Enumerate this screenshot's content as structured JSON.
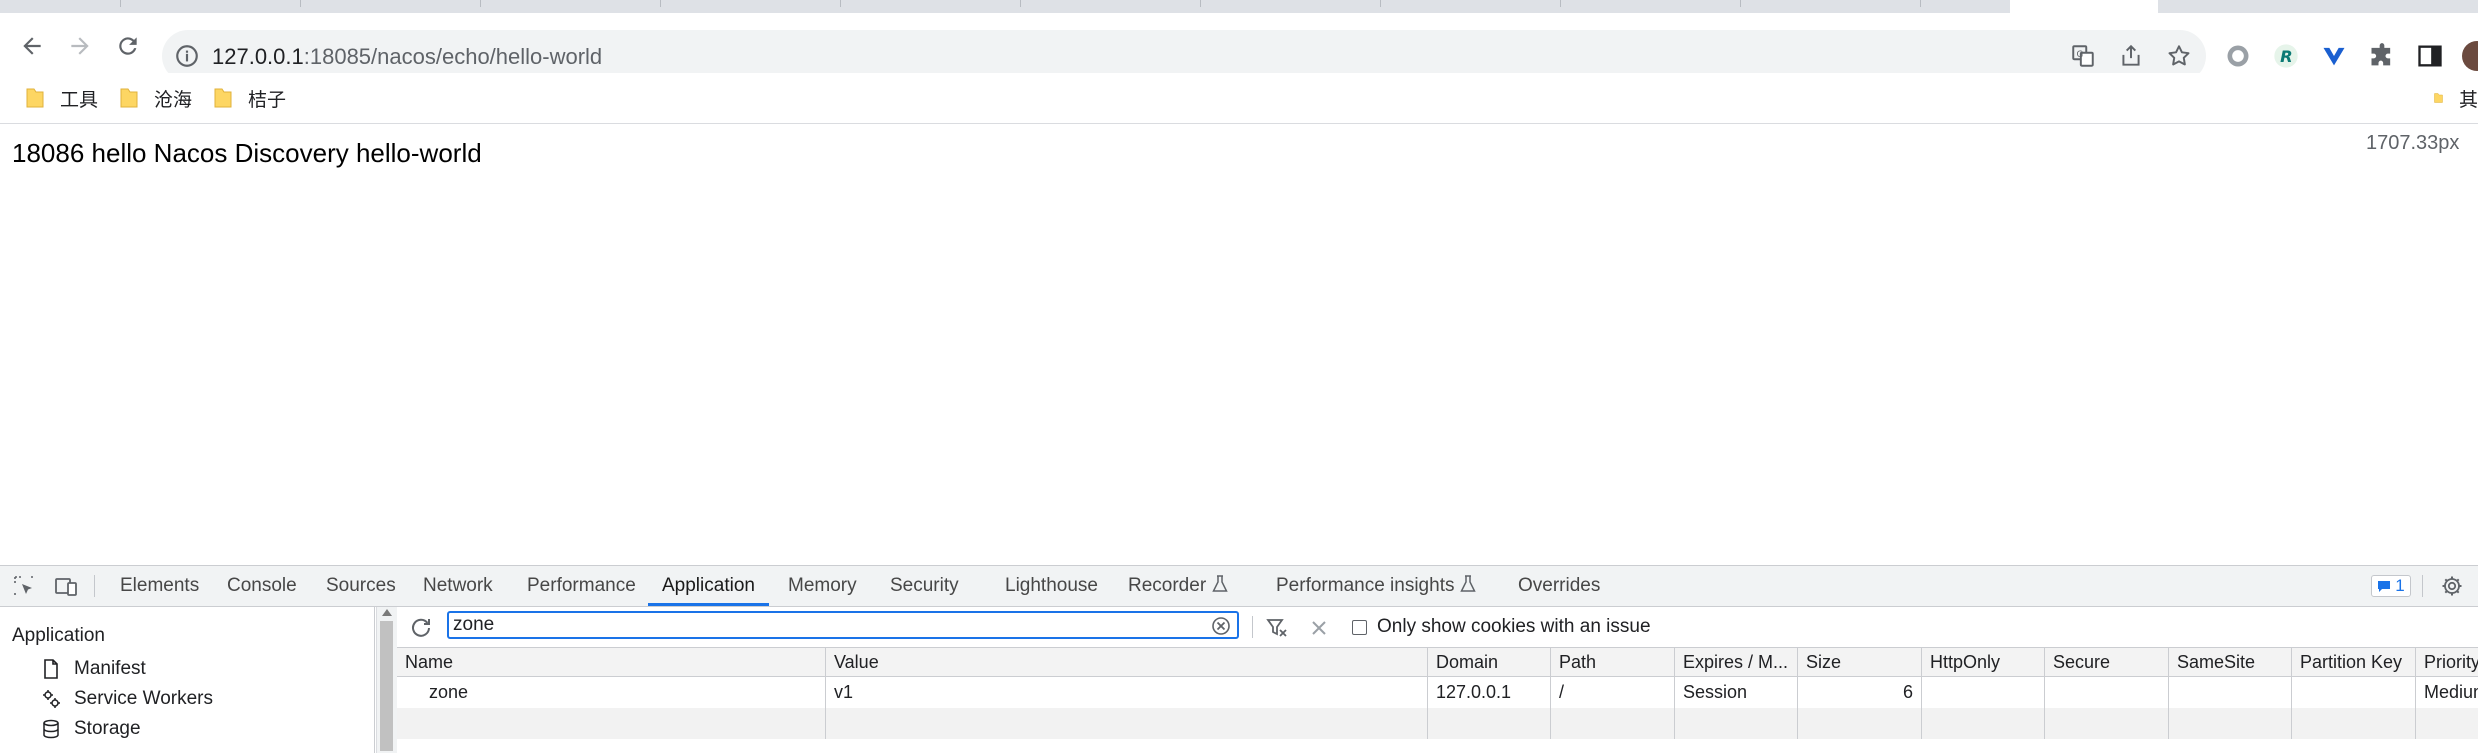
{
  "browser": {
    "url_host": "127.0.0.1",
    "url_rest": ":18085/nacos/echo/hello-world",
    "bookmarks": [
      {
        "label": "工具"
      },
      {
        "label": "沧海"
      },
      {
        "label": "桔子"
      },
      {
        "label": "其"
      }
    ]
  },
  "page": {
    "body_text": "18086 hello Nacos Discovery hello-world",
    "viewport_width_readout": "1707.33px"
  },
  "devtools": {
    "tabs": [
      {
        "label": "Elements"
      },
      {
        "label": "Console"
      },
      {
        "label": "Sources"
      },
      {
        "label": "Network"
      },
      {
        "label": "Performance"
      },
      {
        "label": "Application",
        "active": true
      },
      {
        "label": "Memory"
      },
      {
        "label": "Security"
      },
      {
        "label": "Lighthouse"
      },
      {
        "label": "Recorder"
      },
      {
        "label": "Performance insights"
      },
      {
        "label": "Overrides"
      }
    ],
    "issues_count": "1",
    "sidebar": {
      "title": "Application",
      "items": [
        {
          "label": "Manifest",
          "icon": "document-icon"
        },
        {
          "label": "Service Workers",
          "icon": "gears-icon"
        },
        {
          "label": "Storage",
          "icon": "database-icon"
        }
      ]
    },
    "cookies": {
      "filter_value": "zone",
      "only_issues_label": "Only show cookies with an issue",
      "only_issues_checked": false,
      "columns": [
        "Name",
        "Value",
        "Domain",
        "Path",
        "Expires / M...",
        "Size",
        "HttpOnly",
        "Secure",
        "SameSite",
        "Partition Key",
        "Priority"
      ],
      "rows": [
        {
          "name": "zone",
          "value": "v1",
          "domain": "127.0.0.1",
          "path": "/",
          "expires": "Session",
          "size": "6",
          "httponly": "",
          "secure": "",
          "samesite": "",
          "partition_key": "",
          "priority": "Medium"
        }
      ]
    }
  },
  "colors": {
    "accent": "#1a73e8",
    "chrome_bg": "#dee1e6",
    "omnibox_bg": "#f1f3f4",
    "folder": "#fdd663"
  }
}
